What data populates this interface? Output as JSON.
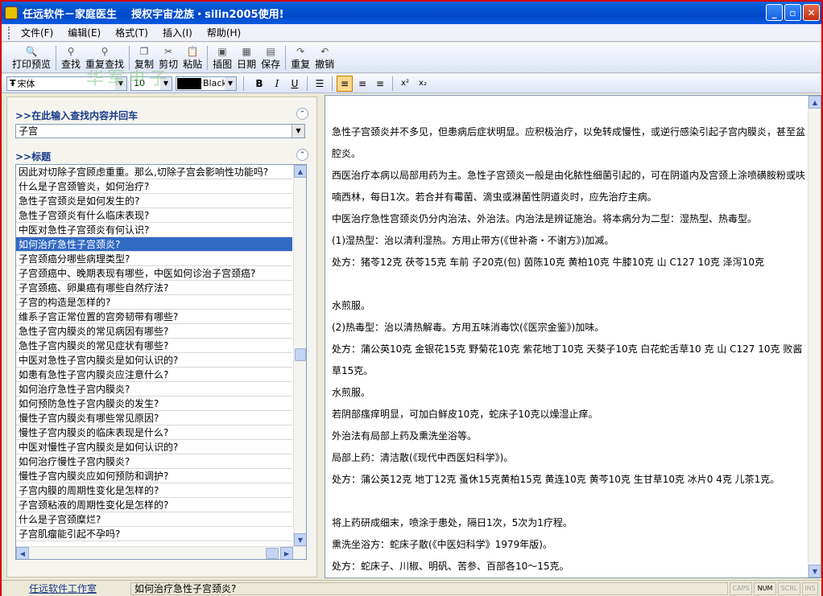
{
  "window": {
    "title": "任远软件－家庭医生    授权宇宙龙族・silin2005使用!",
    "minimize": "_",
    "maximize": "▫",
    "close": "✕"
  },
  "menu": [
    "文件(F)",
    "编辑(E)",
    "格式(T)",
    "插入(I)",
    "帮助(H)"
  ],
  "toolbar": {
    "print_preview": "打印预览",
    "find": "查找",
    "find_again": "重复查找",
    "copy": "复制",
    "cut": "剪切",
    "paste": "粘贴",
    "insert_image": "插图",
    "date": "日期",
    "save": "保存",
    "redo": "重复",
    "undo": "撤销"
  },
  "format": {
    "font": "宋体",
    "size": "10",
    "color_name": "Black",
    "bold": "B",
    "italic": "I",
    "underline": "U",
    "superscript": "x²",
    "subscript": "x₂"
  },
  "watermark": "华军电子",
  "search": {
    "header": ">>在此输入查找内容并回车",
    "value": "子宫"
  },
  "titles": {
    "header": ">>标题",
    "items": [
      "因此对切除子宫顾虑重重。那么,切除子宫会影响性功能吗?",
      "什么是子宫颈管炎，如何治疗?",
      "急性子宫颈炎是如何发生的?",
      "急性子宫颈炎有什么临床表现?",
      "中医对急性子宫颈炎有何认识?",
      "如何治疗急性子宫颈炎?",
      "子宫颈癌分哪些病理类型?",
      "子宫颈癌中、晚期表现有哪些，中医如何诊治子宫颈癌?",
      "子宫颈癌、卵巢癌有哪些自然疗法?",
      "子宫的构造是怎样的?",
      "维系子宫正常位置的宫旁韧带有哪些?",
      "急性子宫内膜炎的常见病因有哪些?",
      "急性子宫内膜炎的常见症状有哪些?",
      "中医对急性子宫内膜炎是如何认识的?",
      "如患有急性子宫内膜炎应注意什么?",
      "如何治疗急性子宫内膜炎?",
      "如何预防急性子宫内膜炎的发生?",
      "慢性子宫内膜炎有哪些常见原因?",
      "慢性子宫内膜炎的临床表现是什么?",
      "中医对慢性子宫内膜炎是如何认识的?",
      "如何治疗慢性子宫内膜炎?",
      "慢性子宫内膜炎应如何预防和调护?",
      "子宫内膜的周期性变化是怎样的?",
      "子宫颈粘液的周期性变化是怎样的?",
      "什么是子宫颈糜烂?",
      "子宫肌瘤能引起不孕吗?"
    ],
    "selected_index": 5
  },
  "content": {
    "paragraphs": [
      "急性子宫颈炎并不多见，但患病后症状明显。应积极治疗，以免转成慢性，或逆行感染引起子宫内膜炎，甚至盆腔炎。",
      "西医治疗本病以局部用药为主。急性子宫颈炎一般是由化脓性细菌引起的，可在阴道内及宫颈上涂喷磺胺粉或呋喃西林，每日1次。若合并有霉菌、滴虫或淋菌性阴道炎时，应先治疗主病。",
      "中医治疗急性宫颈炎仍分内治法、外治法。内治法是辨证施治。将本病分为二型：湿热型、热毒型。",
      "(1)湿热型：治以清利湿热。方用止带方(《世补斋・不谢方》)加减。",
      "处方：猪苓12克  茯苓15克  车前  子20克(包)   茵陈10克  黄柏10克  牛膝10克  山  C127  10克  泽泻10克",
      "水煎服。",
      "(2)热毒型：治以清热解毒。方用五味消毒饮(《医宗金鉴》)加味。",
      "处方：蒲公英10克  金银花15克  野菊花10克  紫花地丁10克  天葵子10克  白花蛇舌草10 克  山  C127  10克  败酱草15克。",
      "水煎服。",
      "若阴部瘙痒明显，可加白鲜皮10克，蛇床子10克以燥湿止痒。",
      "外治法有局部上药及熏洗坐浴等。",
      "局部上药：清洁散(《现代中西医妇科学》)。",
      "处方：蒲公英12克  地丁12克  蚤休15克黄柏15克  黄连10克  黄芩10克  生甘草10克  冰片0 4克  儿茶1克。",
      "将上药研成细末，喷涂于患处，隔日1次，5次为1疗程。",
      "熏洗坐浴方：蛇床子散(《中医妇科学》1979年版)。",
      "处方：蛇床子、川椒、明矾、苦参、百部各10～15克。"
    ]
  },
  "status": {
    "company_link": "任远软件工作室",
    "message": "如何治疗急性子宫颈炎?",
    "caps": "CAPS",
    "num": "NUM",
    "scrl": "SCRL",
    "ins": "INS"
  }
}
